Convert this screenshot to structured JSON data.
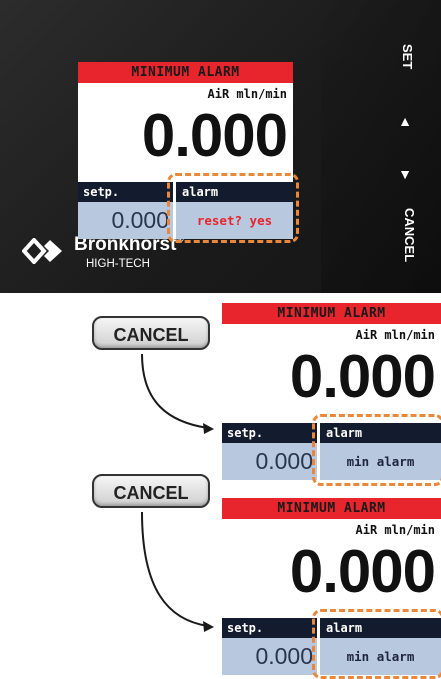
{
  "device": {
    "buttons": {
      "set": "SET",
      "up": "▲",
      "down": "▼",
      "cancel": "CANCEL"
    },
    "brand": {
      "name": "Bronkhorst",
      "registered": "®",
      "subtitle": "HIGH-TECH"
    }
  },
  "screens": [
    {
      "title": "MINIMUM ALARM",
      "unit": "AiR mln/min",
      "value": "0.000",
      "setpoint_label": "setp.",
      "setpoint_value": "0.000",
      "alarm_label": "alarm",
      "alarm_value": "reset? yes"
    },
    {
      "title": "MINIMUM ALARM",
      "unit": "AiR mln/min",
      "value": "0.000",
      "setpoint_label": "setp.",
      "setpoint_value": "0.000",
      "alarm_label": "alarm",
      "alarm_value": "min alarm"
    },
    {
      "title": "MINIMUM ALARM",
      "unit": "AiR mln/min",
      "value": "0.000",
      "setpoint_label": "setp.",
      "setpoint_value": "0.000",
      "alarm_label": "alarm",
      "alarm_value": "min alarm"
    }
  ],
  "steps": [
    {
      "key_label": "CANCEL"
    },
    {
      "key_label": "CANCEL"
    }
  ],
  "colors": {
    "title_bar": "#e8252c",
    "header_bar": "#131c2e",
    "value_field": "#b8c8de",
    "highlight": "#e9873a",
    "reset_text": "#e8252c"
  }
}
